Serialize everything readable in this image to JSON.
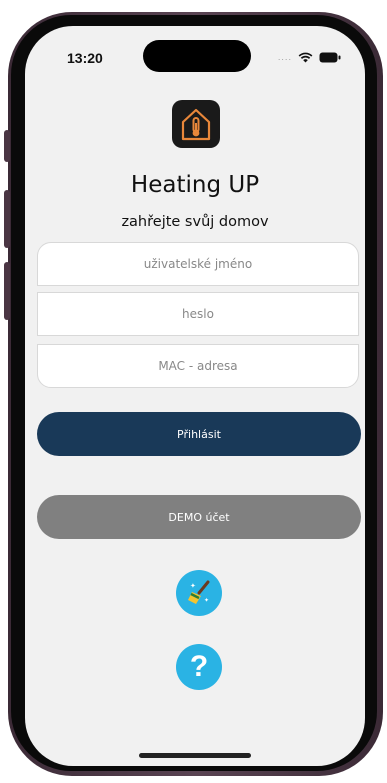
{
  "status_bar": {
    "time": "13:20",
    "dots": "....",
    "icons": [
      "wifi-icon",
      "battery-icon"
    ]
  },
  "app": {
    "title": "Heating UP",
    "subtitle": "zahřejte svůj domov",
    "icon": "house-thermometer-icon"
  },
  "form": {
    "username_placeholder": "uživatelské jméno",
    "password_placeholder": "heslo",
    "mac_placeholder": "MAC - adresa"
  },
  "buttons": {
    "login_label": "Přihlásit",
    "demo_label": "DEMO účet"
  },
  "actions": {
    "clear_icon": "broom-icon",
    "help_icon": "help-icon",
    "help_glyph": "?"
  },
  "colors": {
    "login_button": "#193958",
    "demo_button": "#808080",
    "round_icons": "#2ab3e4",
    "app_icon_accent": "#e8873a"
  }
}
